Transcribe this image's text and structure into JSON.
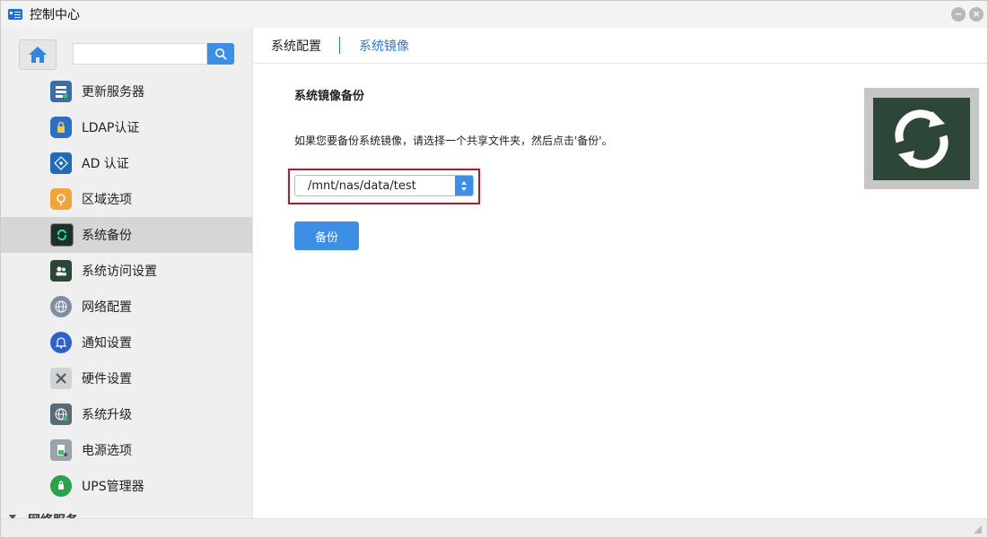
{
  "window": {
    "title": "控制中心"
  },
  "sidebar": {
    "search": {
      "value": "",
      "placeholder": ""
    },
    "items": [
      {
        "label": "更新服务器",
        "icon": "update-server-icon"
      },
      {
        "label": "LDAP认证",
        "icon": "ldap-lock-icon"
      },
      {
        "label": "AD 认证",
        "icon": "ad-network-icon"
      },
      {
        "label": "区域选项",
        "icon": "region-pin-icon"
      },
      {
        "label": "系统备份",
        "icon": "system-backup-icon",
        "active": true
      },
      {
        "label": "系统访问设置",
        "icon": "access-users-icon"
      },
      {
        "label": "网络配置",
        "icon": "network-globe-icon"
      },
      {
        "label": "通知设置",
        "icon": "notification-bell-icon"
      },
      {
        "label": "硬件设置",
        "icon": "hardware-tools-icon"
      },
      {
        "label": "系统升级",
        "icon": "upgrade-globe-icon"
      },
      {
        "label": "电源选项",
        "icon": "power-battery-icon"
      },
      {
        "label": "UPS管理器",
        "icon": "ups-icon"
      }
    ],
    "section": {
      "label": "网络服务"
    }
  },
  "main": {
    "tabs": [
      {
        "label": "系统配置"
      },
      {
        "label": "系统镜像",
        "active": true
      }
    ],
    "section_title": "系统镜像备份",
    "description": "如果您要备份系统镜像，请选择一个共享文件夹，然后点击'备份'。",
    "share_select": {
      "value": "/mnt/nas/data/test"
    },
    "backup_button": "备份"
  },
  "colors": {
    "accent": "#3d8fe6",
    "highlight_border": "#a0252b",
    "active_row": "#d6d6d6"
  }
}
